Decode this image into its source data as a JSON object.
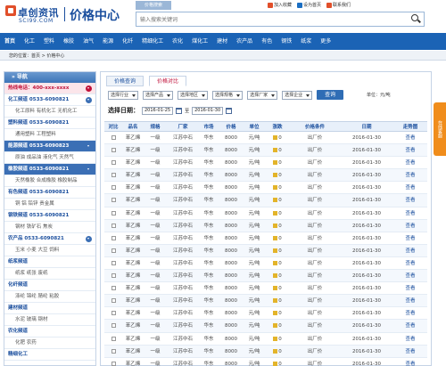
{
  "header": {
    "logo_cn": "卓创资讯",
    "logo_en": "SCI99.COM",
    "center_title": "价格中心",
    "search_tab": "价格搜索",
    "search_placeholder": "输入搜索关键词",
    "top_links": [
      "加入收藏",
      "设为首页",
      "联系我们"
    ]
  },
  "nav": {
    "items": [
      "首页",
      "化工",
      "塑料",
      "橡胶",
      "油气",
      "能源",
      "化纤",
      "精细化工",
      "农化",
      "煤化工",
      "建材",
      "农产品",
      "有色",
      "钢铁",
      "纸浆",
      "更多"
    ]
  },
  "breadcrumb": {
    "text": "您的位置：首页 > 价格中心"
  },
  "sidebar": {
    "title": "导航",
    "rows": [
      {
        "text": "热线电话：400-xxx-xxxx",
        "style": "pink",
        "arrow": true
      },
      {
        "text": "化工频道 0533-6090821",
        "style": "head",
        "arrow": true
      },
      {
        "text": "化工原料  有机化工  无机化工",
        "style": "sub"
      },
      {
        "text": "塑料频道 0533-6090821",
        "style": "head"
      },
      {
        "text": "通用塑料  工程塑料",
        "style": "sub"
      },
      {
        "text": "能源频道 0533-6090823",
        "style": "blue",
        "arrow": true
      },
      {
        "text": "原油  成品油  液化气  天然气",
        "style": "sub"
      },
      {
        "text": "橡胶频道 0533-6090821",
        "style": "blue",
        "arrow": true
      },
      {
        "text": "天然橡胶  合成橡胶  橡胶制品",
        "style": "sub"
      },
      {
        "text": "有色频道 0533-6090821",
        "style": "head"
      },
      {
        "text": "铜  铝  铅锌  贵金属",
        "style": "sub"
      },
      {
        "text": "钢铁频道 0533-6090821",
        "style": "head"
      },
      {
        "text": "钢材  铁矿石  焦炭",
        "style": "sub"
      },
      {
        "text": "农产品 0533-6090821",
        "style": "head",
        "arrow": true
      },
      {
        "text": "玉米  小麦  大豆  饲料",
        "style": "sub"
      },
      {
        "text": "纸浆频道",
        "style": "head"
      },
      {
        "text": "纸浆  纸张  废纸",
        "style": "sub"
      },
      {
        "text": "化纤频道",
        "style": "head"
      },
      {
        "text": "涤纶  锦纶  腈纶  粘胶",
        "style": "sub"
      },
      {
        "text": "建材频道",
        "style": "head"
      },
      {
        "text": "水泥  玻璃  钢材",
        "style": "sub"
      },
      {
        "text": "农化频道",
        "style": "head"
      },
      {
        "text": "化肥  农药",
        "style": "sub"
      },
      {
        "text": "精细化工",
        "style": "head"
      }
    ]
  },
  "main": {
    "tabs": [
      "价格查询",
      "价格对比"
    ],
    "filters": [
      "选择行业",
      "选择产品",
      "选择地区",
      "选择规格",
      "选择厂家",
      "选择企业"
    ],
    "query_label": "查询",
    "unit_label": "单位：元/吨",
    "date_label": "选择日期：",
    "date_from": "2016-01-25",
    "date_sep": "至",
    "date_to": "2016-01-30",
    "columns": [
      "对比",
      "品名",
      "规格",
      "厂家",
      "市场",
      "价格",
      "单位",
      "涨跌",
      "价格条件",
      "日期",
      "走势图"
    ],
    "rows": [
      {
        "name": "苯乙烯",
        "spec": "一级",
        "maker": "江苏中石",
        "market": "华东",
        "price": "8000",
        "unit": "元/吨",
        "chg": "0",
        "cond": "出厂价",
        "date": "2016-01-30",
        "trend": "查看"
      },
      {
        "name": "苯乙烯",
        "spec": "一级",
        "maker": "江苏中石",
        "market": "华东",
        "price": "8000",
        "unit": "元/吨",
        "chg": "0",
        "cond": "出厂价",
        "date": "2016-01-30",
        "trend": "查看"
      },
      {
        "name": "苯乙烯",
        "spec": "一级",
        "maker": "江苏中石",
        "market": "华东",
        "price": "8000",
        "unit": "元/吨",
        "chg": "0",
        "cond": "出厂价",
        "date": "2016-01-30",
        "trend": "查看"
      },
      {
        "name": "苯乙烯",
        "spec": "一级",
        "maker": "江苏中石",
        "market": "华东",
        "price": "8000",
        "unit": "元/吨",
        "chg": "0",
        "cond": "出厂价",
        "date": "2016-01-30",
        "trend": "查看"
      },
      {
        "name": "苯乙烯",
        "spec": "一级",
        "maker": "江苏中石",
        "market": "华东",
        "price": "8000",
        "unit": "元/吨",
        "chg": "0",
        "cond": "出厂价",
        "date": "2016-01-30",
        "trend": "查看"
      },
      {
        "name": "苯乙烯",
        "spec": "一级",
        "maker": "江苏中石",
        "market": "华东",
        "price": "8000",
        "unit": "元/吨",
        "chg": "0",
        "cond": "出厂价",
        "date": "2016-01-30",
        "trend": "查看"
      },
      {
        "name": "苯乙烯",
        "spec": "一级",
        "maker": "江苏中石",
        "market": "华东",
        "price": "8000",
        "unit": "元/吨",
        "chg": "0",
        "cond": "出厂价",
        "date": "2016-01-30",
        "trend": "查看"
      },
      {
        "name": "苯乙烯",
        "spec": "一级",
        "maker": "江苏中石",
        "market": "华东",
        "price": "8000",
        "unit": "元/吨",
        "chg": "0",
        "cond": "出厂价",
        "date": "2016-01-30",
        "trend": "查看"
      },
      {
        "name": "苯乙烯",
        "spec": "一级",
        "maker": "江苏中石",
        "market": "华东",
        "price": "8000",
        "unit": "元/吨",
        "chg": "0",
        "cond": "出厂价",
        "date": "2016-01-30",
        "trend": "查看"
      },
      {
        "name": "苯乙烯",
        "spec": "一级",
        "maker": "江苏中石",
        "market": "华东",
        "price": "8000",
        "unit": "元/吨",
        "chg": "0",
        "cond": "出厂价",
        "date": "2016-01-30",
        "trend": "查看"
      },
      {
        "name": "苯乙烯",
        "spec": "一级",
        "maker": "江苏中石",
        "market": "华东",
        "price": "8000",
        "unit": "元/吨",
        "chg": "0",
        "cond": "出厂价",
        "date": "2016-01-30",
        "trend": "查看"
      },
      {
        "name": "苯乙烯",
        "spec": "一级",
        "maker": "江苏中石",
        "market": "华东",
        "price": "8000",
        "unit": "元/吨",
        "chg": "0",
        "cond": "出厂价",
        "date": "2016-01-30",
        "trend": "查看"
      },
      {
        "name": "苯乙烯",
        "spec": "一级",
        "maker": "江苏中石",
        "market": "华东",
        "price": "8000",
        "unit": "元/吨",
        "chg": "0",
        "cond": "出厂价",
        "date": "2016-01-30",
        "trend": "查看"
      },
      {
        "name": "苯乙烯",
        "spec": "一级",
        "maker": "江苏中石",
        "market": "华东",
        "price": "8000",
        "unit": "元/吨",
        "chg": "0",
        "cond": "出厂价",
        "date": "2016-01-30",
        "trend": "查看"
      },
      {
        "name": "苯乙烯",
        "spec": "一级",
        "maker": "江苏中石",
        "market": "华东",
        "price": "8000",
        "unit": "元/吨",
        "chg": "0",
        "cond": "出厂价",
        "date": "2016-01-30",
        "trend": "查看"
      },
      {
        "name": "苯乙烯",
        "spec": "一级",
        "maker": "江苏中石",
        "market": "华东",
        "price": "8000",
        "unit": "元/吨",
        "chg": "0",
        "cond": "出厂价",
        "date": "2016-01-30",
        "trend": "查看"
      },
      {
        "name": "苯乙烯",
        "spec": "一级",
        "maker": "江苏中石",
        "market": "华东",
        "price": "8000",
        "unit": "元/吨",
        "chg": "0",
        "cond": "出厂价",
        "date": "2016-01-30",
        "trend": "查看"
      },
      {
        "name": "苯乙烯",
        "spec": "一级",
        "maker": "江苏中石",
        "market": "华东",
        "price": "8000",
        "unit": "元/吨",
        "chg": "0",
        "cond": "出厂价",
        "date": "2016-01-30",
        "trend": "查看"
      },
      {
        "name": "苯乙烯",
        "spec": "一级",
        "maker": "江苏中石",
        "market": "华东",
        "price": "8000",
        "unit": "元/吨",
        "chg": "0",
        "cond": "出厂价",
        "date": "2016-01-30",
        "trend": "查看"
      }
    ]
  },
  "float_tab": "在线客服"
}
